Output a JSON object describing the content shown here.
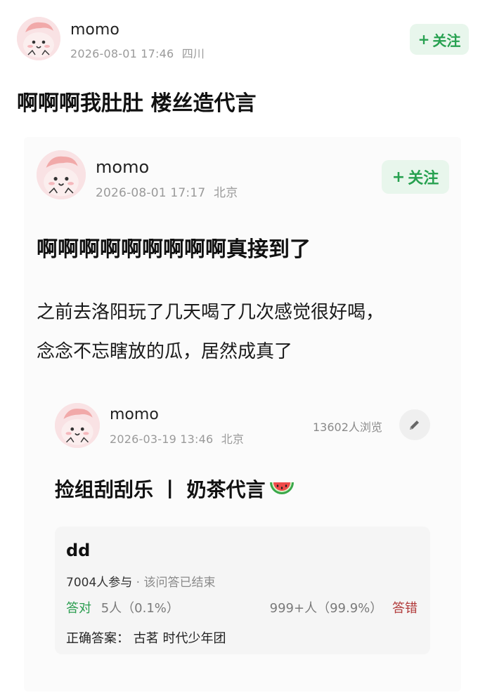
{
  "post": {
    "user": "momo",
    "timestamp": "2026-08-01 17:46",
    "location": "四川",
    "follow_label": "关注",
    "text": "啊啊啊我肚肚 楼丝造代言"
  },
  "repost": {
    "user": "momo",
    "timestamp": "2026-08-01 17:17",
    "location": "北京",
    "follow_label": "关注",
    "title": "啊啊啊啊啊啊啊啊啊真接到了",
    "body_line1": "之前去洛阳玩了几天喝了几次感觉很好喝，",
    "body_line2": "念念不忘瞎放的瓜，居然成真了"
  },
  "original": {
    "user": "momo",
    "timestamp": "2026-03-19 13:46",
    "location": "北京",
    "views": "13602人浏览",
    "title": "捡组刮刮乐 丨 奶茶代言",
    "title_emoji": "watermelon-icon"
  },
  "quiz": {
    "question": "dd",
    "participants": "7004人参与",
    "status": "· 该问答已结束",
    "correct_label": "答对",
    "correct_stats": "5人（0.1%）",
    "wrong_stats": "999+人（99.9%）",
    "wrong_label": "答错",
    "answer_label": "正确答案：",
    "answer_value": "古茗 时代少年团"
  },
  "colors": {
    "follow_bg": "#e8f6ec",
    "follow_text": "#27a150",
    "correct": "#2a9d4f",
    "wrong": "#b13a3a"
  }
}
